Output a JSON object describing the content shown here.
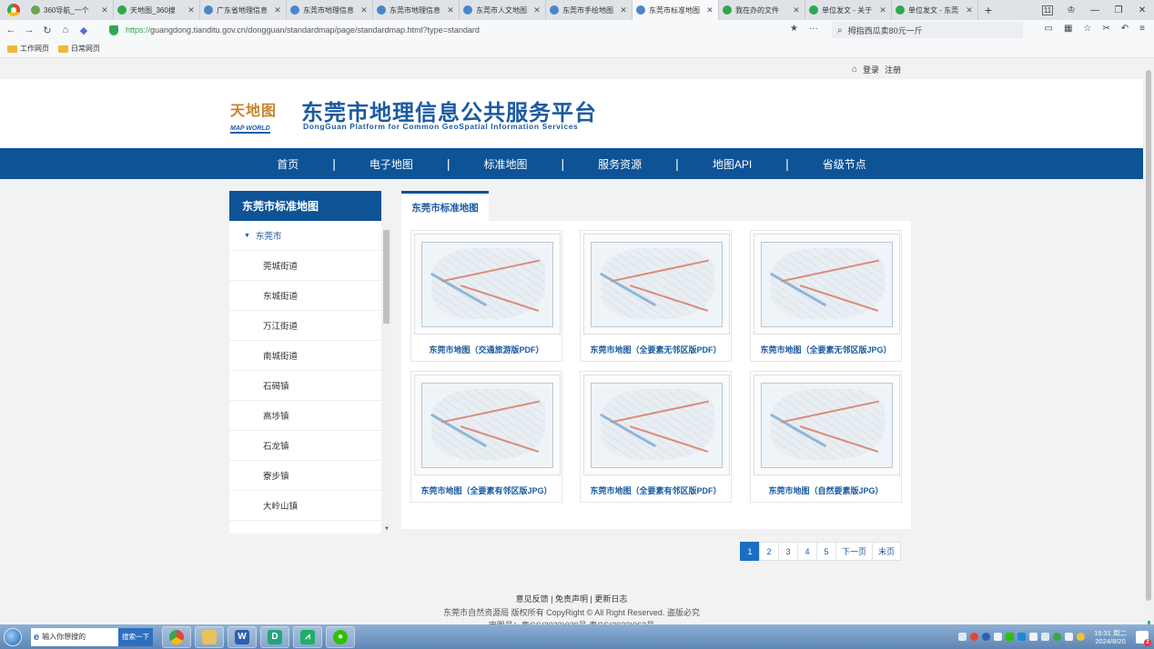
{
  "browser": {
    "tabs": [
      {
        "title": "360导航_一个",
        "favicon_color": "#6aa84f",
        "active": false
      },
      {
        "title": "天地图_360搜",
        "favicon_color": "#2fa84f",
        "active": false
      },
      {
        "title": "广东省地理信息",
        "favicon_color": "#4a86c8",
        "active": false
      },
      {
        "title": "东莞市地理信息",
        "favicon_color": "#4a86c8",
        "active": false
      },
      {
        "title": "东莞市地理信息",
        "favicon_color": "#4a86c8",
        "active": false
      },
      {
        "title": "东莞市人文地图",
        "favicon_color": "#4a86c8",
        "active": false
      },
      {
        "title": "东莞市手绘地图",
        "favicon_color": "#4a86c8",
        "active": false
      },
      {
        "title": "东莞市标准地图",
        "favicon_color": "#4a86c8",
        "active": true
      },
      {
        "title": "我在办的文件",
        "favicon_color": "#2fa84f",
        "active": false
      },
      {
        "title": "单位发文 - 关于",
        "favicon_color": "#2fa84f",
        "active": false
      },
      {
        "title": "单位发文 - 东莞",
        "favicon_color": "#2fa84f",
        "active": false
      }
    ],
    "tab_count": "11",
    "url_https": "https://",
    "url_rest": "guangdong.tianditu.gov.cn/dongguan/standardmap/page/standardmap.html?type=standard",
    "search_placeholder": "拇指西瓜卖80元一斤",
    "bookmarks": [
      "工作网页",
      "日常网页"
    ]
  },
  "header": {
    "login": "登录",
    "register": "注册",
    "logo_cn": "天地图",
    "logo_en": "MAP WORLD",
    "title": "东莞市地理信息公共服务平台",
    "subtitle": "DongGuan Platform for Common GeoSpatial Information Services"
  },
  "nav": [
    "首页",
    "电子地图",
    "标准地图",
    "服务资源",
    "地图API",
    "省级节点"
  ],
  "sidebar": {
    "title": "东莞市标准地图",
    "root": "东莞市",
    "items": [
      "莞城街道",
      "东城街道",
      "万江街道",
      "南城街道",
      "石碣镇",
      "高埗镇",
      "石龙镇",
      "寮步镇",
      "大岭山镇"
    ]
  },
  "content": {
    "tab": "东莞市标准地图",
    "cards": [
      {
        "label": "东莞市地图（交通旅游版PDF）"
      },
      {
        "label": "东莞市地图（全要素无邻区版PDF）"
      },
      {
        "label": "东莞市地图（全要素无邻区版JPG）"
      },
      {
        "label": "东莞市地图（全要素有邻区版JPG）"
      },
      {
        "label": "东莞市地图（全要素有邻区版PDF）"
      },
      {
        "label": "东莞市地图（自然要素版JPG）"
      }
    ]
  },
  "pagination": {
    "pages": [
      "1",
      "2",
      "3",
      "4",
      "5"
    ],
    "current": "1",
    "next": "下一页",
    "last": "末页"
  },
  "footer": {
    "links": "意见反馈 | 免责声明 | 更新日志",
    "copyright": "东莞市自然资源局  版权所有 CopyRight © All Right Reserved. 盗版必究",
    "icp": "审图号：粤GS(2023)029号  粤GS(2023)063号"
  },
  "taskbar": {
    "search_text": "输入你想搜的",
    "search_button": "搜索一下",
    "time": "15:31 周二",
    "date": "2024/8/20",
    "notifications": "2"
  }
}
